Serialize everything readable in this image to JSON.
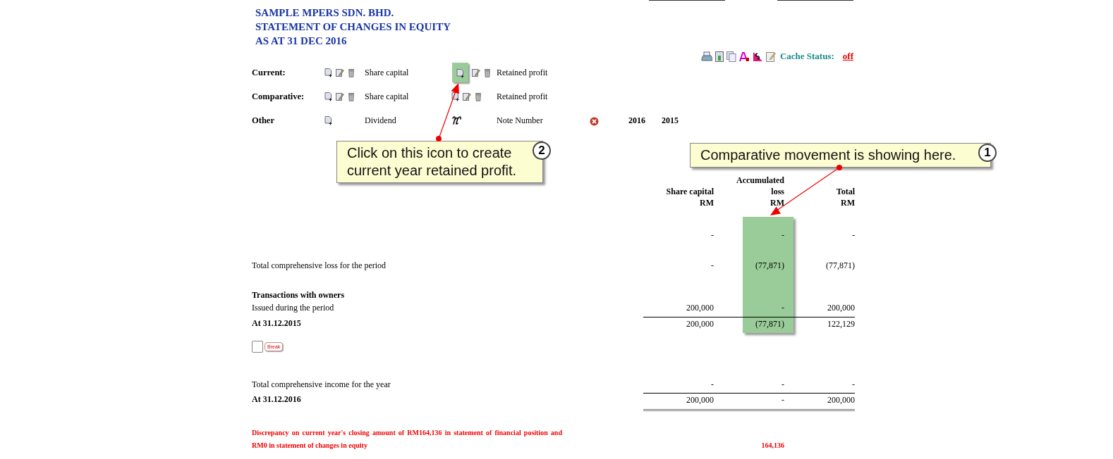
{
  "header": {
    "company": "SAMPLE MPERS SDN. BHD.",
    "title": "STATEMENT OF CHANGES IN EQUITY",
    "date": "AS AT 31 DEC 2016"
  },
  "toolbar": {
    "cache_label": "Cache Status:",
    "cache_value": "off"
  },
  "controls": [
    {
      "label": "Current:",
      "items": [
        {
          "name": "Share capital",
          "kind": "full",
          "highlighted": false
        },
        {
          "name": "Retained profit",
          "kind": "full",
          "highlighted": true
        }
      ]
    },
    {
      "label": "Comparative:",
      "items": [
        {
          "name": "Share capital",
          "kind": "full",
          "highlighted": false
        },
        {
          "name": "Retained profit",
          "kind": "full",
          "highlighted": false
        }
      ]
    },
    {
      "label": "Other",
      "items": [
        {
          "name": "Dividend",
          "kind": "add",
          "highlighted": false
        },
        {
          "name": "Note Number",
          "kind": "note",
          "highlighted": false
        }
      ],
      "years": [
        "2016",
        "2015"
      ]
    }
  ],
  "callouts": [
    {
      "number": "2",
      "text": "Click on this icon to create current year retained profit."
    },
    {
      "number": "1",
      "text": "Comparative movement is showing here."
    }
  ],
  "table": {
    "columns": [
      {
        "lines": [
          "Share capital",
          "RM"
        ],
        "highlighted": false
      },
      {
        "lines": [
          "Accumulated",
          "loss",
          "RM"
        ],
        "highlighted": true
      },
      {
        "lines": [
          "Total",
          "RM"
        ],
        "highlighted": false
      }
    ],
    "rows": [
      {
        "kind": "line",
        "values": [
          "-",
          "-",
          "-"
        ]
      },
      {
        "kind": "line",
        "label": "Total comprehensive loss for the period",
        "values": [
          "-",
          "(77,871)",
          "(77,871)"
        ]
      },
      {
        "kind": "heading",
        "label": "Transactions with owners"
      },
      {
        "kind": "line",
        "label": "Issued during the period",
        "values": [
          "200,000",
          "-",
          "200,000"
        ]
      },
      {
        "kind": "total",
        "label": "At 31.12.2015",
        "values": [
          "200,000",
          "(77,871)",
          "122,129"
        ]
      },
      {
        "kind": "break",
        "label": "Break",
        "checked": false
      },
      {
        "kind": "line",
        "label": "Total comprehensive income for the year",
        "values": [
          "-",
          "-",
          "-"
        ]
      },
      {
        "kind": "grand_total",
        "label": "At 31.12.2016",
        "values": [
          "200,000",
          "-",
          "200,000"
        ]
      }
    ]
  },
  "discrepancy": {
    "before": "Discrepancy on ",
    "link": "current year's",
    "after": " closing amount of RM164,136 in statement of financial position and RM0 in statement of changes in equity",
    "amount": "164,136"
  }
}
